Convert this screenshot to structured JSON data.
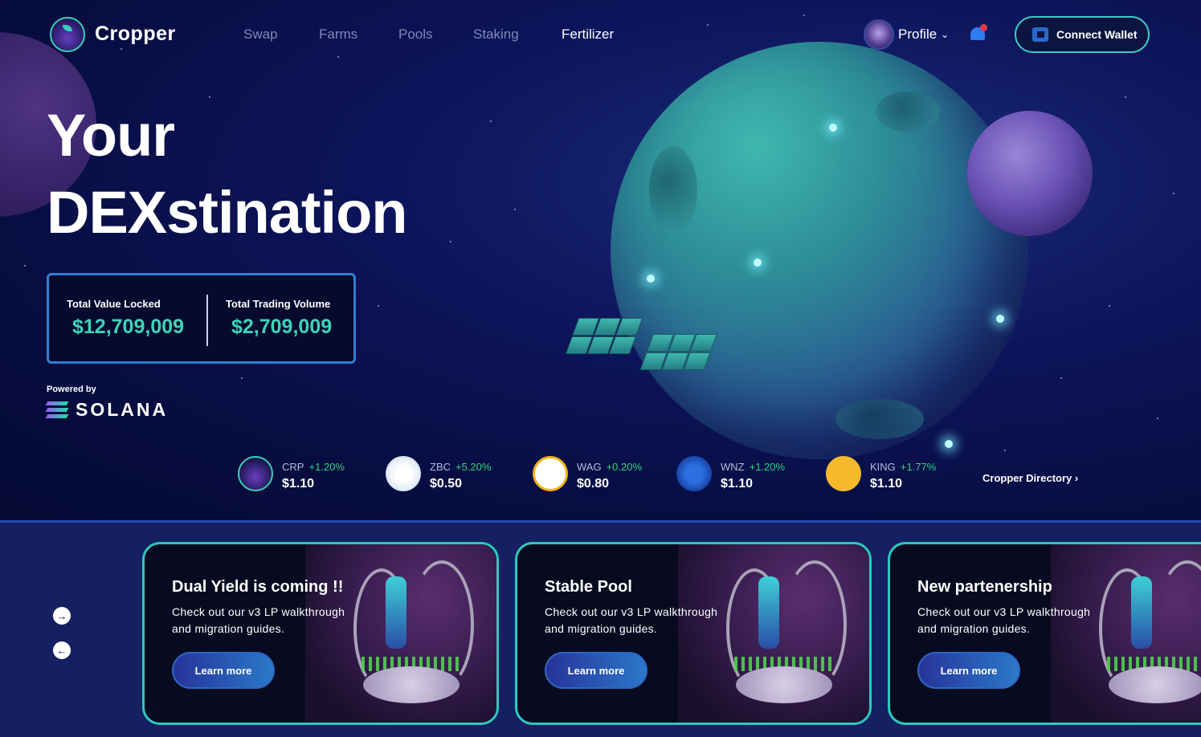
{
  "brand": {
    "name": "Cropper",
    "logo_icon": "cropper-fruit-icon"
  },
  "nav": {
    "items": [
      {
        "label": "Swap",
        "active": false
      },
      {
        "label": "Farms",
        "active": false
      },
      {
        "label": "Pools",
        "active": false
      },
      {
        "label": "Staking",
        "active": false
      },
      {
        "label": "Fertilizer",
        "active": true
      }
    ]
  },
  "header": {
    "profile_label": "Profile",
    "notification_icon": "bell-icon",
    "connect_wallet_label": "Connect Wallet"
  },
  "hero": {
    "title_line1": "Your",
    "title_line2": "DEXstination"
  },
  "stats": {
    "tvl_label": "Total Value Locked",
    "tvl_value": "$12,709,009",
    "volume_label": "Total Trading Volume",
    "volume_value": "$2,709,009"
  },
  "powered_by": {
    "label": "Powered by",
    "name": "SOLANA"
  },
  "tickers": [
    {
      "symbol": "CRP",
      "change": "+1.20%",
      "price": "$1.10",
      "icon": "crp-token-icon"
    },
    {
      "symbol": "ZBC",
      "change": "+5.20%",
      "price": "$0.50",
      "icon": "zbc-token-icon"
    },
    {
      "symbol": "WAG",
      "change": "+0.20%",
      "price": "$0.80",
      "icon": "wag-bee-token-icon"
    },
    {
      "symbol": "WNZ",
      "change": "+1.20%",
      "price": "$1.10",
      "icon": "wnz-token-icon"
    },
    {
      "symbol": "KING",
      "change": "+1.77%",
      "price": "$1.10",
      "icon": "king-token-icon"
    }
  ],
  "directory_label": "Cropper Directory",
  "cards": [
    {
      "title": "Dual Yield is coming !!",
      "description": "Check out our v3 LP walkthrough and migration guides.",
      "button": "Learn more"
    },
    {
      "title": "Stable Pool",
      "description": "Check out our v3 LP walkthrough and migration guides.",
      "button": "Learn more"
    },
    {
      "title": "New partenership",
      "description": "Check out our v3 LP walkthrough and migration guides.",
      "button": "Learn more"
    }
  ],
  "colors": {
    "accent_teal": "#3dd4b8",
    "positive_change": "#32d47a",
    "border_blue": "#2f7fd0",
    "button_gradient_start": "#27339a",
    "button_gradient_end": "#2b78c9"
  }
}
